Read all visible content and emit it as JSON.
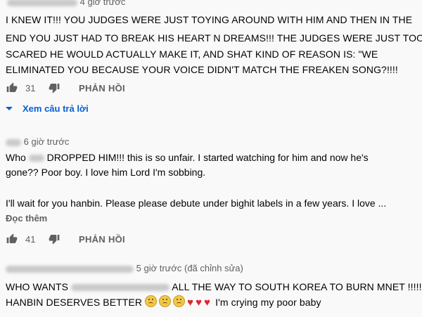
{
  "comments": [
    {
      "author": "",
      "time": "4 giờ trước",
      "lines": [
        "I KNEW IT!!! YOU JUDGES WERE JUST TOYING AROUND WITH HIM AND THEN IN THE",
        "END YOU JUST HAD TO BREAK HIS HEART N DREAMS!!! THE JUDGES WERE JUST TOO",
        "SCARED HE WOULD ACTUALLY MAKE IT, AND SHAT KIND OF REASON IS: \"WE",
        "ELIMINATED YOU BECAUSE YOUR VOICE DIDN'T MATCH THE FREAKEN SONG?!!!!"
      ],
      "likes": "31",
      "reply_label": "PHẢN HỒI",
      "view_replies": "Xem câu trả lời"
    },
    {
      "author": "",
      "time": "6 giờ trước",
      "line1_a": "Who",
      "line1_b": "DROPPED HIM!!! this is so unfair. I started watching for him and now he's",
      "line2": "gone?? Poor boy. I love him Lord I'm sobbing.",
      "line3": "I'll wait for you hanbin. Please please debute under bighit labels in a few years. I love ...",
      "read_more": "Đọc thêm",
      "likes": "41",
      "reply_label": "PHẢN HỒI"
    },
    {
      "author": "",
      "time": "5 giờ trước (đã chỉnh sửa)",
      "line1_a": "WHO WANTS",
      "line1_b": "ALL THE WAY TO SOUTH KOREA TO BURN MNET !!!!!",
      "line2_a": "HANBIN DESERVES BETTER",
      "line2_b": "I'm crying my poor baby"
    }
  ],
  "icons": {
    "like": "thumbs-up-icon",
    "dislike": "thumbs-down-icon",
    "expand": "caret-down-icon",
    "sad_face": "worried-face-emoji",
    "heart": "red-heart-emoji"
  },
  "colors": {
    "background": "#f9f9f9",
    "link": "#065fd4",
    "meta": "#606060",
    "heart": "#e0242e"
  }
}
